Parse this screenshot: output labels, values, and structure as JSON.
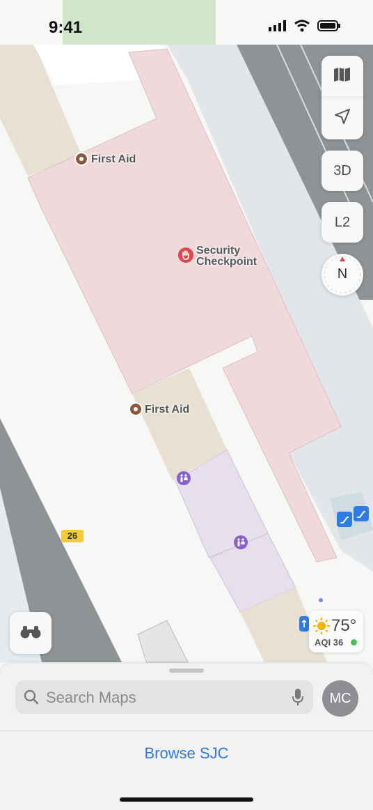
{
  "status_bar": {
    "time": "9:41"
  },
  "map": {
    "pois": [
      {
        "name": "first-aid-upper",
        "label": "First Aid"
      },
      {
        "name": "security-checkpoint",
        "label_line1": "Security",
        "label_line2": "Checkpoint"
      },
      {
        "name": "first-aid-lower",
        "label": "First Aid"
      }
    ],
    "gate_badge": "26",
    "colors": {
      "security_zone": "#efd9dc",
      "restroom_zone": "#e6dfec",
      "concourse": "#e3e6e9",
      "corridor_tan": "#e8e0d3",
      "accent_blue": "#2f7be0"
    }
  },
  "controls": {
    "map_mode_icon": "map-icon",
    "locate_icon": "location-arrow-icon",
    "view_3d": "3D",
    "level": "L2",
    "compass": "N"
  },
  "weather": {
    "temp": "75°",
    "aqi": "AQI 36"
  },
  "search": {
    "placeholder": "Search Maps"
  },
  "avatar": {
    "initials": "MC"
  },
  "browse": {
    "label": "Browse SJC"
  }
}
